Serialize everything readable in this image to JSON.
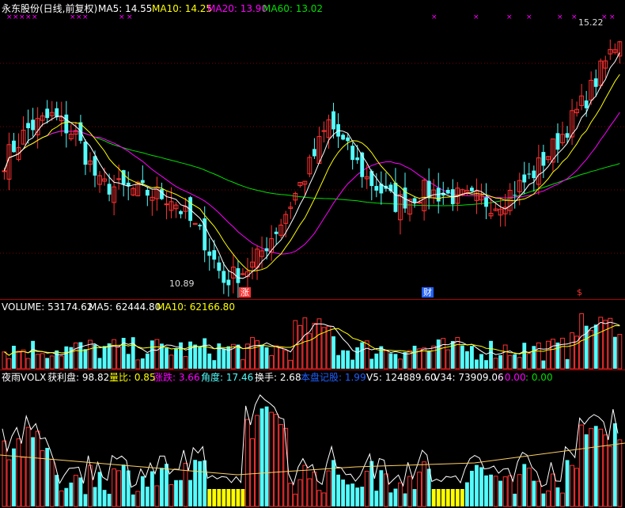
{
  "colors": {
    "up": "#ff3232",
    "down": "#54fcfc",
    "ma5": "#ffffff",
    "ma10": "#ffff00",
    "ma20": "#ff00ff",
    "ma60": "#00e000",
    "grid": "#800000",
    "highlight": "#ffff00"
  },
  "header": {
    "stock_name": "永东股份(日线,前复权)",
    "ma5": "MA5: 14.55",
    "ma10": "MA10: 14.25",
    "ma20": "MA20: 13.90",
    "ma60": "MA60: 13.02"
  },
  "price_panel": {
    "high_label": "15.22",
    "low_label": "10.89",
    "markers": [
      "涨",
      "财",
      "$"
    ]
  },
  "volume_panel": {
    "volume": "VOLUME: 53174.62",
    "ma5": "MA5: 62444.80",
    "ma10": "MA10: 62166.80"
  },
  "indicator_panel": {
    "name": "夜雨VOLX",
    "profit": "获利盘: 98.82",
    "ratio": "量比: 0.85",
    "change": "涨跌: 3.66",
    "angle": "角度: 17.46",
    "turnover": "换手: 2.68",
    "hidden": "本盘记股: 1.99",
    "v5": "V5: 124889.60",
    "v34": "V34: 73909.06",
    "z1": ": 0.00",
    "z2": ": 0.00"
  },
  "chart_data": {
    "type": "candlestick",
    "bars": 130,
    "price_range": [
      10.89,
      15.22
    ],
    "series": [
      {
        "name": "MA5",
        "value": 14.55
      },
      {
        "name": "MA10",
        "value": 14.25
      },
      {
        "name": "MA20",
        "value": 13.9
      },
      {
        "name": "MA60",
        "value": 13.02
      }
    ],
    "high": 15.22,
    "low": 10.89
  }
}
